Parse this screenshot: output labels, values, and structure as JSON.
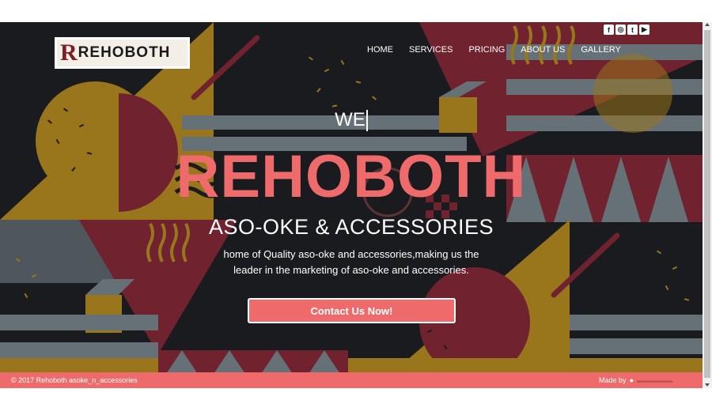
{
  "logo": {
    "mark": "R",
    "text": "REHOBOTH"
  },
  "nav": {
    "items": [
      {
        "label": "HOME"
      },
      {
        "label": "SERVICES"
      },
      {
        "label": "PRICING"
      },
      {
        "label": "ABOUT US"
      },
      {
        "label": "GALLERY"
      }
    ]
  },
  "social": {
    "icons": [
      "facebook-icon",
      "instagram-icon",
      "twitter-icon",
      "youtube-icon"
    ]
  },
  "hero": {
    "typed_text": "WE",
    "brand": "REHOBOTH",
    "subtitle": "ASO-OKE & ACCESSORIES",
    "description": "home of Quality aso-oke and accessories,making us the leader in the marketing of aso-oke and accessories.",
    "cta_label": "Contact Us Now!"
  },
  "footer": {
    "copyright": "© 2017 Rehoboth asoke_n_accessories",
    "made_by": "Made by"
  },
  "colors": {
    "accent": "#ef6b6b",
    "background": "#1d1e22",
    "mustard": "#a6801f",
    "maroon": "#7a2532",
    "slate": "#6f7a82"
  }
}
